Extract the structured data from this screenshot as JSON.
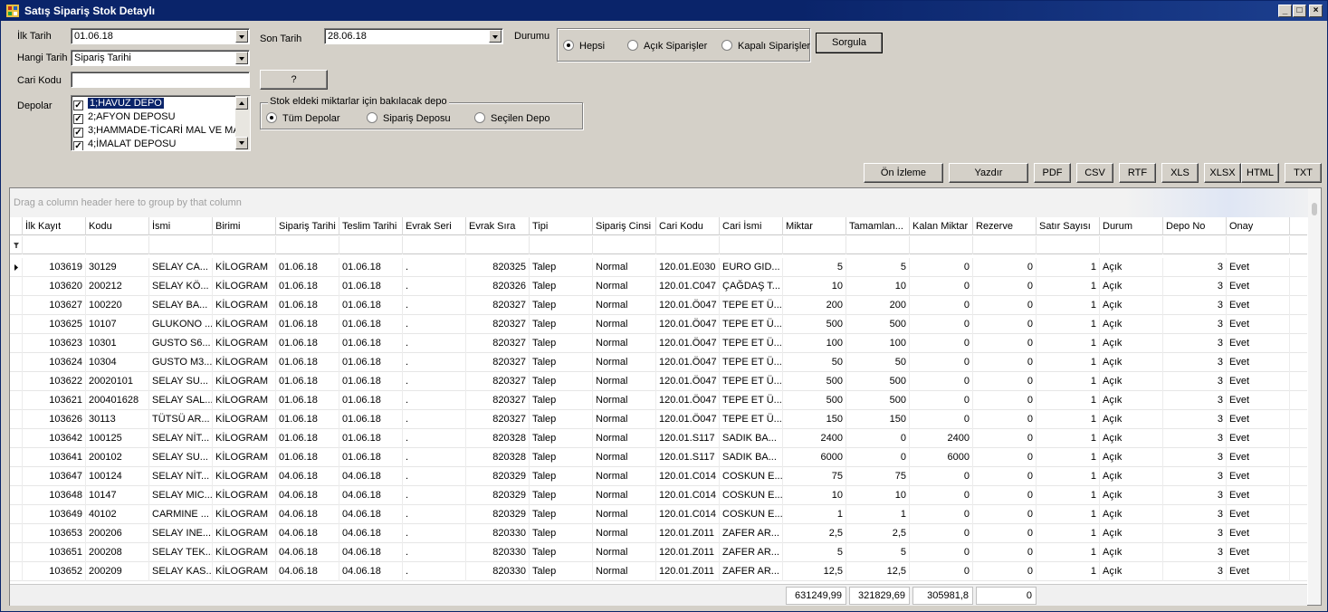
{
  "window": {
    "title": "Satış Sipariş  Stok Detaylı"
  },
  "filters": {
    "ilk_tarih_label": "İlk Tarih",
    "ilk_tarih_value": "01.06.18",
    "son_tarih_label": "Son Tarih",
    "son_tarih_value": "28.06.18",
    "durumu_label": "Durumu",
    "hangi_tarih_label": "Hangi Tarih",
    "hangi_tarih_value": "Sipariş Tarihi",
    "cari_kodu_label": "Cari Kodu",
    "cari_kodu_value": "",
    "lookup_label": "?",
    "depolar_label": "Depolar",
    "depolar": [
      {
        "label": "1;HAVUZ DEPO",
        "checked": true,
        "selected": true
      },
      {
        "label": "2;AFYON DEPOSU",
        "checked": true,
        "selected": false
      },
      {
        "label": "3;HAMMADE-TİCARİ MAL VE MA",
        "checked": true,
        "selected": false
      },
      {
        "label": "4;İMALAT DEPOSU",
        "checked": true,
        "selected": false
      }
    ],
    "durum_options": {
      "hepsi": "Hepsi",
      "acik": "Açık Siparişler",
      "kapali": "Kapalı Siparişler"
    },
    "sorgula_label": "Sorgula",
    "stok_group_title": "Stok eldeki miktarlar için bakılacak depo",
    "stok_options": {
      "tum": "Tüm Depolar",
      "siparis": "Sipariş Deposu",
      "secilen": "Seçilen Depo"
    }
  },
  "export": {
    "onizleme": "Ön İzleme",
    "yazdir": "Yazdır",
    "pdf": "PDF",
    "csv": "CSV",
    "rtf": "RTF",
    "xls": "XLS",
    "xlsx": "XLSX",
    "html": "HTML",
    "txt": "TXT"
  },
  "grid": {
    "group_hint": "Drag a column header here to group by that column",
    "columns": [
      "İlk Kayıt",
      "Kodu",
      "İsmi",
      "Birimi",
      "Sipariş Tarihi",
      "Teslim Tarihi",
      "Evrak Seri",
      "Evrak Sıra",
      "Tipi",
      "Sipariş Cinsi",
      "Cari Kodu",
      "Cari İsmi",
      "Miktar",
      "Tamamlan...",
      "Kalan Miktar",
      "Rezerve",
      "Satır Sayısı",
      "Durum",
      "Depo No",
      "Onay"
    ],
    "rows": [
      [
        "103619",
        "30129",
        "SELAY CA...",
        "KİLOGRAM",
        "01.06.18",
        "01.06.18",
        ".",
        "820325",
        "Talep",
        "Normal",
        "120.01.E030",
        "EURO GID...",
        "5",
        "5",
        "0",
        "0",
        "1",
        "Açık",
        "3",
        "Evet"
      ],
      [
        "103620",
        "200212",
        "SELAY KÖ...",
        "KİLOGRAM",
        "01.06.18",
        "01.06.18",
        ".",
        "820326",
        "Talep",
        "Normal",
        "120.01.C047",
        "ÇAĞDAŞ T...",
        "10",
        "10",
        "0",
        "0",
        "1",
        "Açık",
        "3",
        "Evet"
      ],
      [
        "103627",
        "100220",
        "SELAY BA...",
        "KİLOGRAM",
        "01.06.18",
        "01.06.18",
        ".",
        "820327",
        "Talep",
        "Normal",
        "120.01.Ö047",
        "TEPE ET Ü...",
        "200",
        "200",
        "0",
        "0",
        "1",
        "Açık",
        "3",
        "Evet"
      ],
      [
        "103625",
        "10107",
        "GLUKONO ...",
        "KİLOGRAM",
        "01.06.18",
        "01.06.18",
        ".",
        "820327",
        "Talep",
        "Normal",
        "120.01.Ö047",
        "TEPE ET Ü...",
        "500",
        "500",
        "0",
        "0",
        "1",
        "Açık",
        "3",
        "Evet"
      ],
      [
        "103623",
        "10301",
        "GUSTO S6...",
        "KİLOGRAM",
        "01.06.18",
        "01.06.18",
        ".",
        "820327",
        "Talep",
        "Normal",
        "120.01.Ö047",
        "TEPE ET Ü...",
        "100",
        "100",
        "0",
        "0",
        "1",
        "Açık",
        "3",
        "Evet"
      ],
      [
        "103624",
        "10304",
        "GUSTO M3...",
        "KİLOGRAM",
        "01.06.18",
        "01.06.18",
        ".",
        "820327",
        "Talep",
        "Normal",
        "120.01.Ö047",
        "TEPE ET Ü...",
        "50",
        "50",
        "0",
        "0",
        "1",
        "Açık",
        "3",
        "Evet"
      ],
      [
        "103622",
        "20020101",
        "SELAY SU...",
        "KİLOGRAM",
        "01.06.18",
        "01.06.18",
        ".",
        "820327",
        "Talep",
        "Normal",
        "120.01.Ö047",
        "TEPE ET Ü...",
        "500",
        "500",
        "0",
        "0",
        "1",
        "Açık",
        "3",
        "Evet"
      ],
      [
        "103621",
        "200401628",
        "SELAY SAL...",
        "KİLOGRAM",
        "01.06.18",
        "01.06.18",
        ".",
        "820327",
        "Talep",
        "Normal",
        "120.01.Ö047",
        "TEPE ET Ü...",
        "500",
        "500",
        "0",
        "0",
        "1",
        "Açık",
        "3",
        "Evet"
      ],
      [
        "103626",
        "30113",
        "TÜTSÜ AR...",
        "KİLOGRAM",
        "01.06.18",
        "01.06.18",
        ".",
        "820327",
        "Talep",
        "Normal",
        "120.01.Ö047",
        "TEPE ET Ü...",
        "150",
        "150",
        "0",
        "0",
        "1",
        "Açık",
        "3",
        "Evet"
      ],
      [
        "103642",
        "100125",
        "SELAY NİT...",
        "KİLOGRAM",
        "01.06.18",
        "01.06.18",
        ".",
        "820328",
        "Talep",
        "Normal",
        "120.01.S117",
        "SADIK BA...",
        "2400",
        "0",
        "2400",
        "0",
        "1",
        "Açık",
        "3",
        "Evet"
      ],
      [
        "103641",
        "200102",
        "SELAY SU...",
        "KİLOGRAM",
        "01.06.18",
        "01.06.18",
        ".",
        "820328",
        "Talep",
        "Normal",
        "120.01.S117",
        "SADIK BA...",
        "6000",
        "0",
        "6000",
        "0",
        "1",
        "Açık",
        "3",
        "Evet"
      ],
      [
        "103647",
        "100124",
        "SELAY NİT...",
        "KİLOGRAM",
        "04.06.18",
        "04.06.18",
        ".",
        "820329",
        "Talep",
        "Normal",
        "120.01.C014",
        "COSKUN E...",
        "75",
        "75",
        "0",
        "0",
        "1",
        "Açık",
        "3",
        "Evet"
      ],
      [
        "103648",
        "10147",
        "SELAY MIC...",
        "KİLOGRAM",
        "04.06.18",
        "04.06.18",
        ".",
        "820329",
        "Talep",
        "Normal",
        "120.01.C014",
        "COSKUN E...",
        "10",
        "10",
        "0",
        "0",
        "1",
        "Açık",
        "3",
        "Evet"
      ],
      [
        "103649",
        "40102",
        "CARMINE ...",
        "KİLOGRAM",
        "04.06.18",
        "04.06.18",
        ".",
        "820329",
        "Talep",
        "Normal",
        "120.01.C014",
        "COSKUN E...",
        "1",
        "1",
        "0",
        "0",
        "1",
        "Açık",
        "3",
        "Evet"
      ],
      [
        "103653",
        "200206",
        "SELAY INE...",
        "KİLOGRAM",
        "04.06.18",
        "04.06.18",
        ".",
        "820330",
        "Talep",
        "Normal",
        "120.01.Z011",
        "ZAFER AR...",
        "2,5",
        "2,5",
        "0",
        "0",
        "1",
        "Açık",
        "3",
        "Evet"
      ],
      [
        "103651",
        "200208",
        "SELAY TEK...",
        "KİLOGRAM",
        "04.06.18",
        "04.06.18",
        ".",
        "820330",
        "Talep",
        "Normal",
        "120.01.Z011",
        "ZAFER AR...",
        "5",
        "5",
        "0",
        "0",
        "1",
        "Açık",
        "3",
        "Evet"
      ],
      [
        "103652",
        "200209",
        "SELAY KAS...",
        "KİLOGRAM",
        "04.06.18",
        "04.06.18",
        ".",
        "820330",
        "Talep",
        "Normal",
        "120.01.Z011",
        "ZAFER AR...",
        "12,5",
        "12,5",
        "0",
        "0",
        "1",
        "Açık",
        "3",
        "Evet"
      ]
    ],
    "totals": {
      "miktar": "631249,99",
      "tamamlanan": "321829,69",
      "kalan": "305981,8",
      "rezerve": "0"
    }
  }
}
